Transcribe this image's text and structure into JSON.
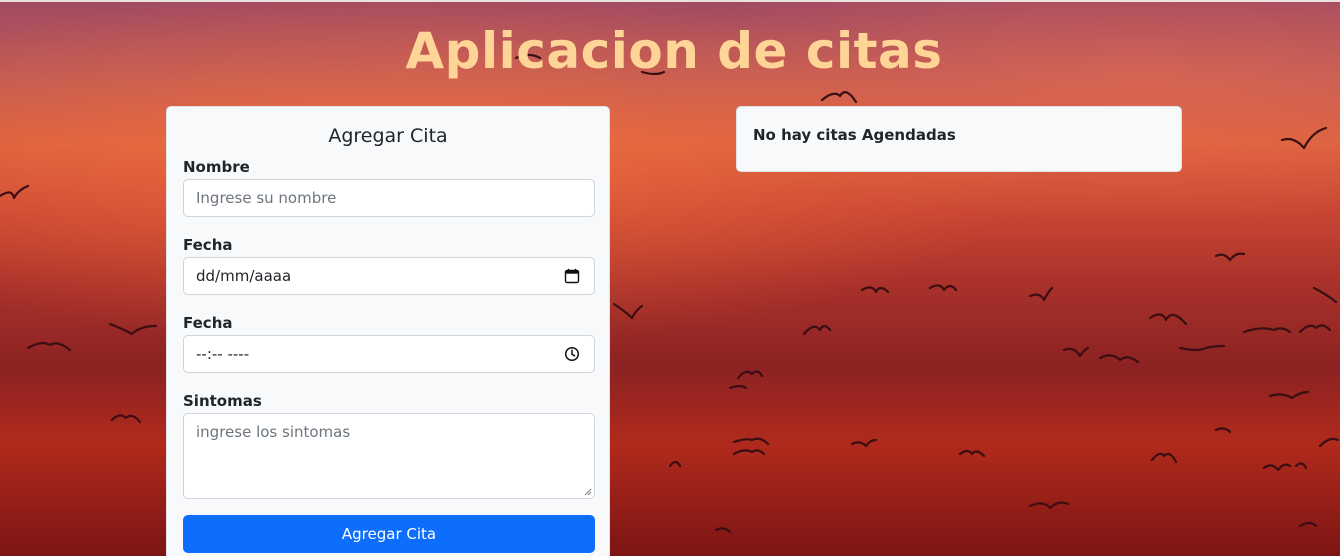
{
  "header": {
    "title": "Aplicacion de citas"
  },
  "form": {
    "title": "Agregar Cita",
    "name_label": "Nombre",
    "name_placeholder": "Ingrese su nombre",
    "date_label": "Fecha",
    "date_value": "dd/mm/aaaa",
    "time_label": "Fecha",
    "time_value": "--:-- ----",
    "symptoms_label": "Sintomas",
    "symptoms_placeholder": "ingrese los sintomas",
    "submit_label": "Agregar Cita"
  },
  "appointments": {
    "empty_message": "No hay citas Agendadas"
  },
  "icons": {
    "date": "calendar-icon",
    "time": "clock-icon"
  },
  "colors": {
    "title": "#fed596",
    "primary_button": "#0d6efd",
    "card_background": "#f8f9fa"
  }
}
